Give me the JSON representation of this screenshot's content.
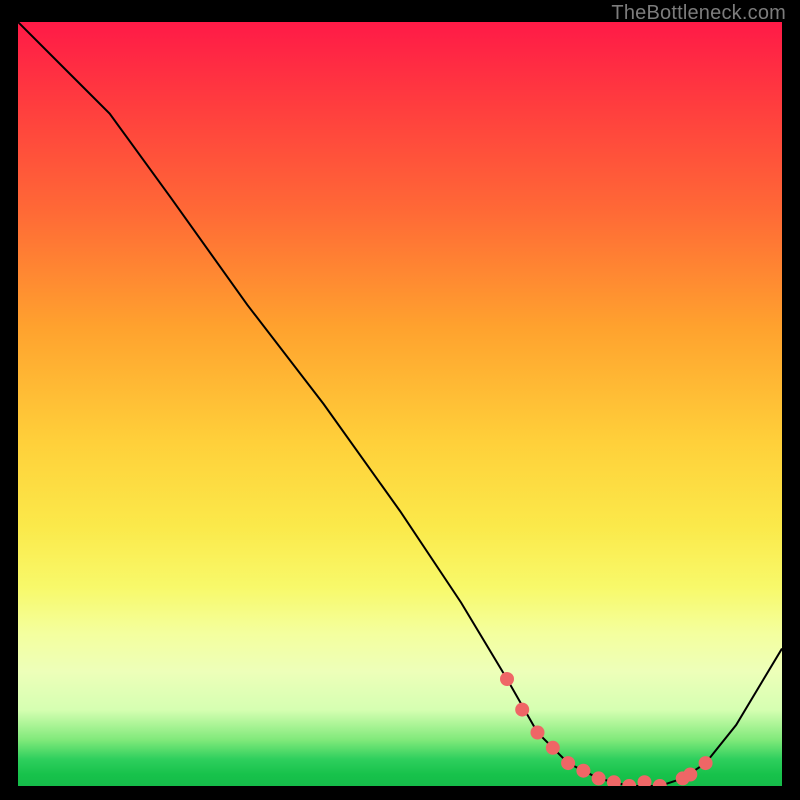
{
  "attribution": "TheBottleneck.com",
  "chart_data": {
    "type": "line",
    "title": "",
    "xlabel": "",
    "ylabel": "",
    "ylim": [
      0,
      100
    ],
    "xlim": [
      0,
      100
    ],
    "series": [
      {
        "name": "bottleneck-curve",
        "x": [
          0,
          7,
          12,
          20,
          30,
          40,
          50,
          58,
          64,
          68,
          72,
          76,
          80,
          84,
          87,
          90,
          94,
          100
        ],
        "y": [
          100,
          93,
          88,
          77,
          63,
          50,
          36,
          24,
          14,
          7,
          3,
          1,
          0,
          0,
          1,
          3,
          8,
          18
        ]
      }
    ],
    "markers": {
      "name": "bottleneck-valley-markers",
      "color": "#ef6666",
      "x": [
        64,
        66,
        68,
        70,
        72,
        74,
        76,
        78,
        80,
        82,
        84,
        87,
        88,
        90
      ],
      "y": [
        14,
        10,
        7,
        5,
        3,
        2,
        1,
        0.5,
        0,
        0.5,
        0,
        1,
        1.5,
        3
      ]
    },
    "background_gradient": {
      "top": "#ff1a47",
      "mid_top": "#ffa22e",
      "mid": "#fbe94a",
      "mid_bottom": "#edffb9",
      "bottom": "#15bc49"
    }
  }
}
